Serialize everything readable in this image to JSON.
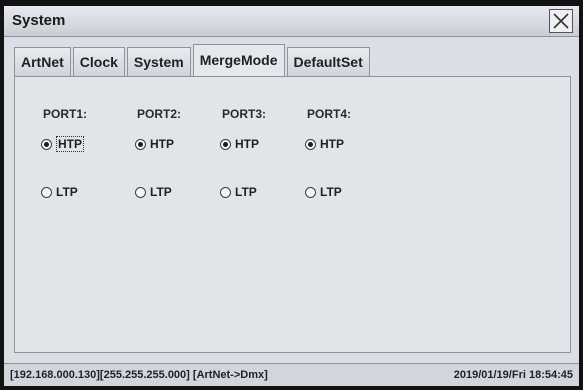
{
  "window": {
    "title": "System",
    "close_icon": "close-icon"
  },
  "tabs": [
    {
      "label": "ArtNet"
    },
    {
      "label": "Clock"
    },
    {
      "label": "System"
    },
    {
      "label": "MergeMode",
      "active": true
    },
    {
      "label": "DefaultSet"
    }
  ],
  "ports": [
    {
      "label": "PORT1:",
      "htp_label": "HTP",
      "ltp_label": "LTP",
      "selected": "HTP"
    },
    {
      "label": "PORT2:",
      "htp_label": "HTP",
      "ltp_label": "LTP",
      "selected": "HTP"
    },
    {
      "label": "PORT3:",
      "htp_label": "HTP",
      "ltp_label": "LTP",
      "selected": "HTP"
    },
    {
      "label": "PORT4:",
      "htp_label": "HTP",
      "ltp_label": "LTP",
      "selected": "HTP"
    }
  ],
  "status": {
    "ip": "[192.168.000.130]",
    "mask": "[255.255.255.000]",
    "mode": "[ArtNet->Dmx]",
    "datetime": "2019/01/19/Fri  18:54:45"
  }
}
